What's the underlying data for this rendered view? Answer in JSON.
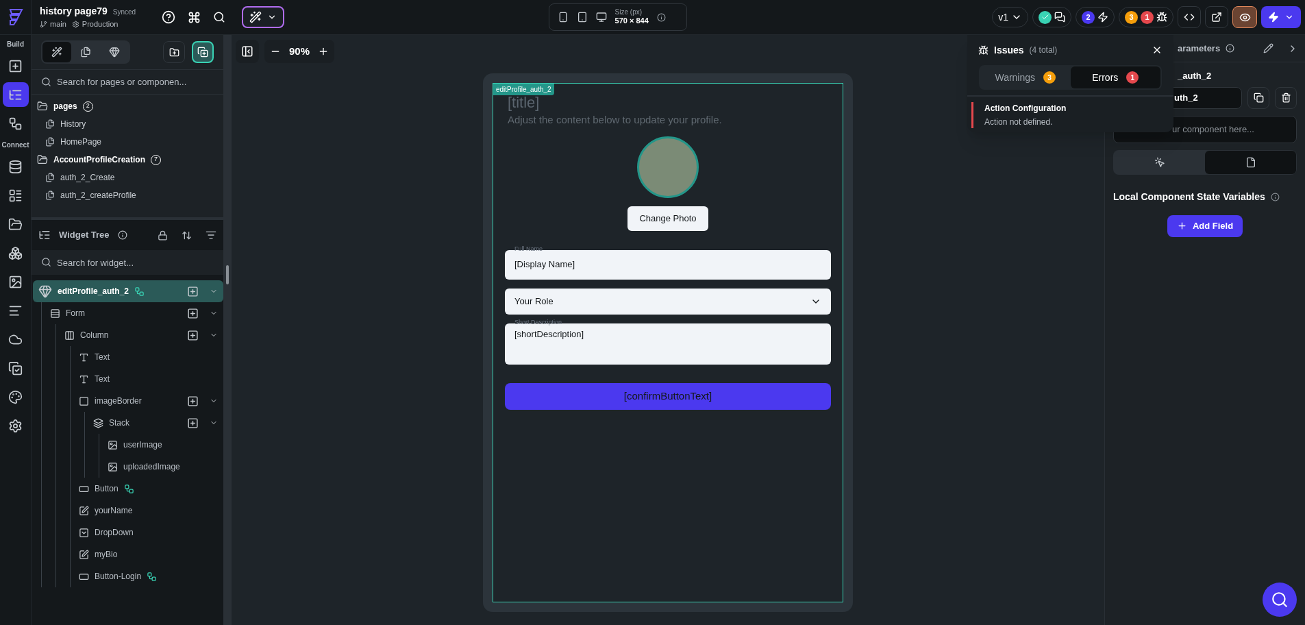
{
  "topbar": {
    "project_title": "history page79",
    "sync_status": "Synced",
    "branch": "main",
    "environment": "Production",
    "size_label": "Size (px)",
    "size_value": "570 × 844",
    "version": "v1",
    "agent_count": "2",
    "warning_count": "3",
    "error_count": "1"
  },
  "rail": {
    "sections": [
      {
        "label": "Build",
        "items": [
          {
            "kind": "add-widget",
            "selected": false
          },
          {
            "kind": "tree",
            "selected": true
          },
          {
            "kind": "connect",
            "selected": false
          }
        ]
      },
      {
        "label": "Connect",
        "items": [
          {
            "kind": "database",
            "selected": false
          },
          {
            "kind": "list",
            "selected": false
          },
          {
            "kind": "folder",
            "selected": false
          },
          {
            "kind": "cluster",
            "selected": false
          },
          {
            "kind": "image",
            "selected": false
          },
          {
            "kind": "lines",
            "selected": false
          },
          {
            "kind": "cloud",
            "selected": false
          },
          {
            "kind": "check-plus",
            "selected": false
          },
          {
            "kind": "palette",
            "selected": false
          },
          {
            "kind": "settings",
            "selected": false
          }
        ]
      }
    ]
  },
  "pages_panel": {
    "tabs": [
      {
        "kind": "pages-components",
        "selected": true
      },
      {
        "kind": "pages",
        "selected": false
      },
      {
        "kind": "components",
        "selected": false
      }
    ],
    "search": {
      "placeholder": "Search for pages or componen..."
    },
    "folders": [
      {
        "name": "pages",
        "count": "2",
        "children": [
          {
            "name": "History"
          },
          {
            "name": "HomePage"
          }
        ]
      },
      {
        "name": "AccountProfileCreation",
        "count": "7",
        "children": [
          {
            "name": "auth_2_Create"
          },
          {
            "name": "auth_2_createProfile"
          }
        ]
      }
    ]
  },
  "widget_tree": {
    "title": "Widget Tree",
    "search": {
      "placeholder": "Search for widget..."
    },
    "nodes": [
      {
        "name": "editProfile_auth_2",
        "kind": "component",
        "selected": true,
        "has_action": true,
        "children": [
          {
            "name": "Form",
            "kind": "form",
            "selected": false,
            "has_action": false,
            "children": [
              {
                "name": "Column",
                "kind": "column",
                "selected": false,
                "has_action": false,
                "children": [
                  {
                    "name": "Text",
                    "kind": "text",
                    "selected": false,
                    "has_action": false
                  },
                  {
                    "name": "Text",
                    "kind": "text",
                    "selected": false,
                    "has_action": false
                  },
                  {
                    "name": "imageBorder",
                    "kind": "container",
                    "selected": false,
                    "has_action": false,
                    "children": [
                      {
                        "name": "Stack",
                        "kind": "stack",
                        "selected": false,
                        "has_action": false,
                        "children": [
                          {
                            "name": "userImage",
                            "kind": "image",
                            "selected": false,
                            "has_action": false
                          },
                          {
                            "name": "uploadedImage",
                            "kind": "image",
                            "selected": false,
                            "has_action": false
                          }
                        ]
                      }
                    ]
                  },
                  {
                    "name": "Button",
                    "kind": "button",
                    "selected": false,
                    "has_action": true
                  },
                  {
                    "name": "yourName",
                    "kind": "textfield",
                    "selected": false,
                    "has_action": false
                  },
                  {
                    "name": "DropDown",
                    "kind": "dropdown",
                    "selected": false,
                    "has_action": false
                  },
                  {
                    "name": "myBio",
                    "kind": "textfield",
                    "selected": false,
                    "has_action": false
                  },
                  {
                    "name": "Button-Login",
                    "kind": "button",
                    "selected": false,
                    "has_action": true
                  }
                ]
              }
            ]
          }
        ]
      }
    ]
  },
  "canvas": {
    "zoom": "90%",
    "component_badge": "editProfile_auth_2",
    "title": "[title]",
    "subtitle": "Adjust the content below to update your profile.",
    "change_photo": "Change Photo",
    "fields": [
      {
        "kind": "text",
        "label": "Full Name",
        "value": "[Display Name]"
      },
      {
        "kind": "dropdown",
        "value": "Your Role"
      },
      {
        "kind": "textarea",
        "label": "Short Description",
        "value": "[shortDescription]"
      }
    ],
    "confirm_button": "[confirmButtonText]"
  },
  "issues": {
    "title": "Issues",
    "total": "(4 total)",
    "tabs": [
      {
        "label": "Warnings",
        "count": "3",
        "color": "#f59e0b",
        "selected": false
      },
      {
        "label": "Errors",
        "count": "1",
        "color": "#e5484d",
        "selected": true
      }
    ],
    "items": [
      {
        "title": "Action Configuration",
        "message": "Action not defined."
      }
    ]
  },
  "right_panel": {
    "header": "arameters",
    "name": "_auth_2",
    "name_value": "uth_2",
    "description_placeholder": "ur component here...",
    "tabs": [
      {
        "kind": "actions",
        "selected": false
      },
      {
        "kind": "state",
        "selected": true
      }
    ],
    "section_title": "Local Component State Variables",
    "add_button": "Add Field"
  }
}
